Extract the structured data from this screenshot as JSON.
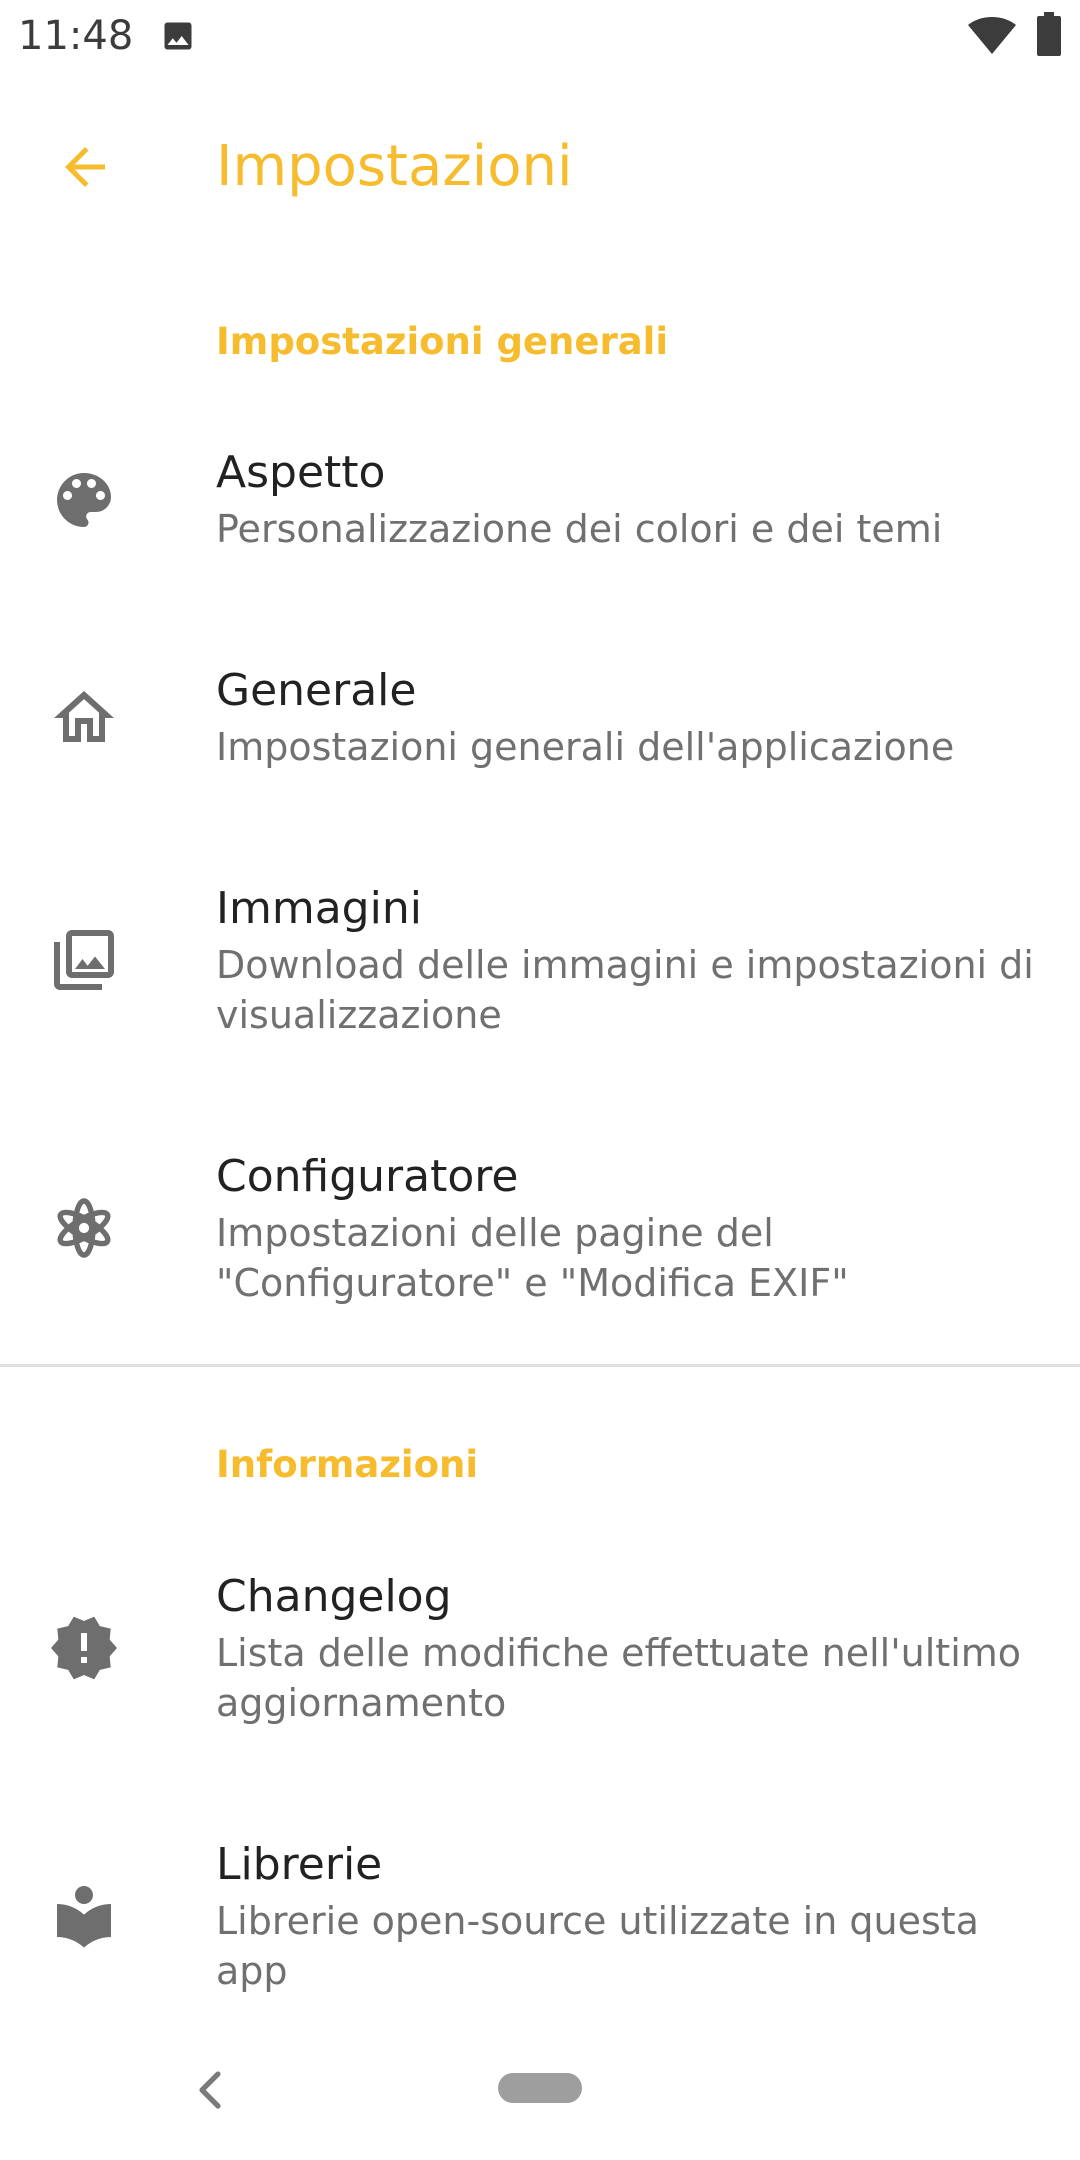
{
  "status_bar": {
    "time": "11:48"
  },
  "app_bar": {
    "title": "Impostazioni"
  },
  "colors": {
    "accent": "#f7bc2d",
    "icon": "#6e6e6e",
    "title_text": "#222222",
    "summary_text": "#707070"
  },
  "sections": [
    {
      "header": "Impostazioni generali",
      "items": [
        {
          "icon": "palette-icon",
          "title": "Aspetto",
          "summary": "Personalizzazione dei colori e dei temi"
        },
        {
          "icon": "home-icon",
          "title": "Generale",
          "summary": "Impostazioni generali dell'applicazione"
        },
        {
          "icon": "photo-library-icon",
          "title": "Immagini",
          "summary": "Download delle immagini e impostazioni di visualizzazione"
        },
        {
          "icon": "flower-icon",
          "title": "Configuratore",
          "summary": "Impostazioni delle pagine del \"Configuratore\" e \"Modifica EXIF\""
        }
      ]
    },
    {
      "header": "Informazioni",
      "items": [
        {
          "icon": "new-releases-icon",
          "title": "Changelog",
          "summary": "Lista delle modifiche effettuate nell'ultimo aggiornamento"
        },
        {
          "icon": "local-library-icon",
          "title": "Librerie",
          "summary": "Librerie open-source utilizzate in questa app"
        }
      ]
    }
  ]
}
